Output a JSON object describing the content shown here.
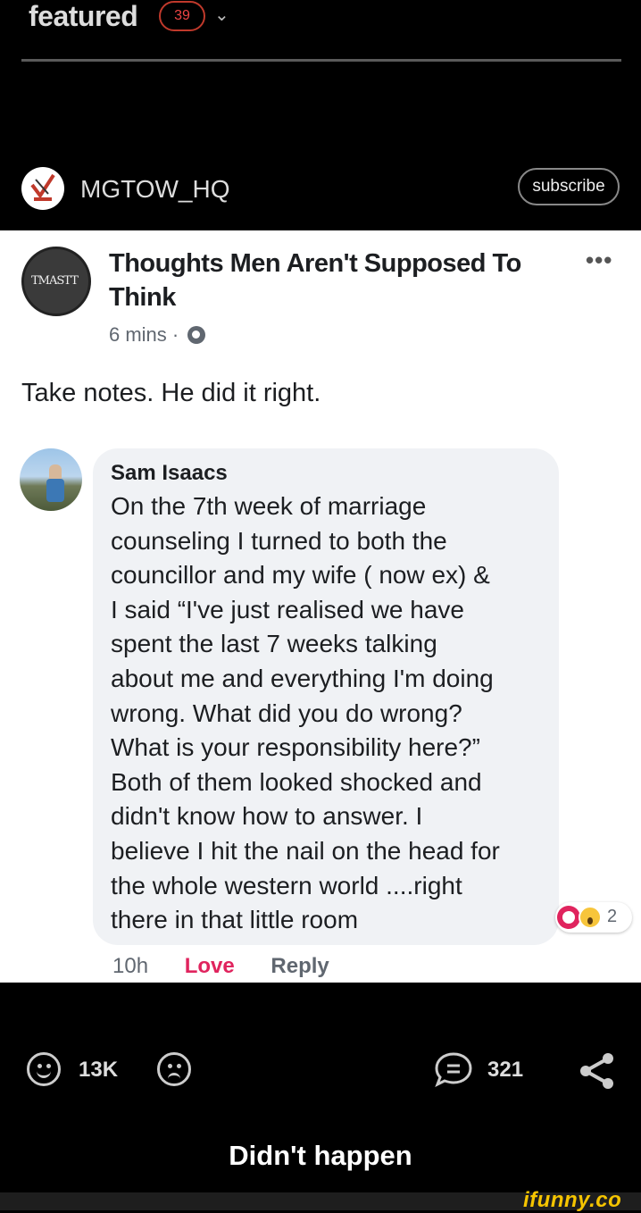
{
  "header": {
    "title": "featured",
    "badge_count": "39"
  },
  "account": {
    "username": "MGTOW_HQ",
    "subscribe_label": "subscribe"
  },
  "post": {
    "page_name": "Thoughts Men Aren't Supposed To Think",
    "page_avatar_text": "TMASTT",
    "time": "6 mins",
    "caption": "Take notes. He did it right.",
    "comment": {
      "author": "Sam Isaacs",
      "lines": [
        "On the 7th week of marriage",
        "counseling I turned to both the",
        "councillor and my wife ( now ex) &",
        "I said “I've just realised we have",
        "spent the last 7 weeks talking",
        "about me and everything I'm doing",
        "wrong. What did you do wrong?",
        "What is your responsibility here?”",
        "Both of them looked shocked and",
        "didn't know how to answer. I",
        "believe I hit the nail on the head for",
        "the whole western world ....right",
        "there in that little room"
      ],
      "reaction_count": "2",
      "time": "10h",
      "love_label": "Love",
      "reply_label": "Reply"
    }
  },
  "actions": {
    "smile_count": "13K",
    "comment_count": "321"
  },
  "meme_title": "Didn't happen",
  "watermark": "ifunny.co",
  "colors": {
    "badge": "#c0392b",
    "love": "#e0245e",
    "watermark": "#f5c400"
  }
}
